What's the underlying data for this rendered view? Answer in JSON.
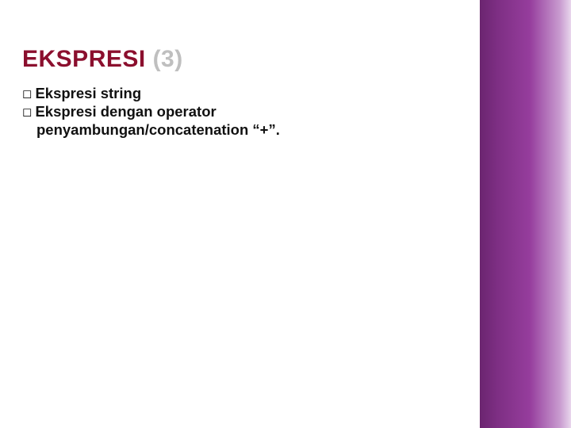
{
  "title": {
    "main": "EKSPRESI",
    "paren": "(3)"
  },
  "bullets": [
    {
      "bold": "Ekspresi",
      "rest": "string"
    },
    {
      "bold": "Ekspresi",
      "rest": "dengan operator",
      "cont": "penyambungan/concatenation “+”."
    }
  ]
}
